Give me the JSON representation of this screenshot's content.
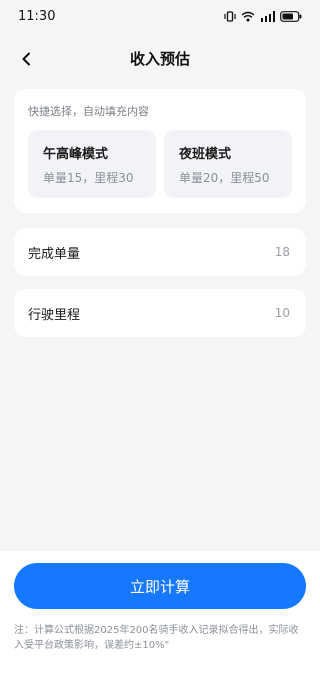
{
  "status_bar": {
    "time": "11:30",
    "icons": [
      "vibrate-icon",
      "wifi-icon",
      "signal-icon",
      "battery-icon"
    ]
  },
  "nav": {
    "back_icon": "chevron-left-icon",
    "title": "收入预估"
  },
  "quick_select": {
    "hint": "快捷选择，自动填充内容",
    "modes": [
      {
        "title": "午高峰模式",
        "desc": "单量15，里程30"
      },
      {
        "title": "夜班模式",
        "desc": "单量20，里程50"
      }
    ]
  },
  "fields": [
    {
      "label": "完成单量",
      "value": "18"
    },
    {
      "label": "行驶里程",
      "value": "10"
    }
  ],
  "action": {
    "calculate_label": "立即计算"
  },
  "footnote": "注：计算公式根据2025年200名骑手收入记录拟合得出，实际收入受平台政策影响，误差约±10%\"",
  "colors": {
    "accent": "#1677ff",
    "background": "#f4f5f7",
    "card": "#ffffff",
    "mode_card": "#f2f3f6"
  }
}
